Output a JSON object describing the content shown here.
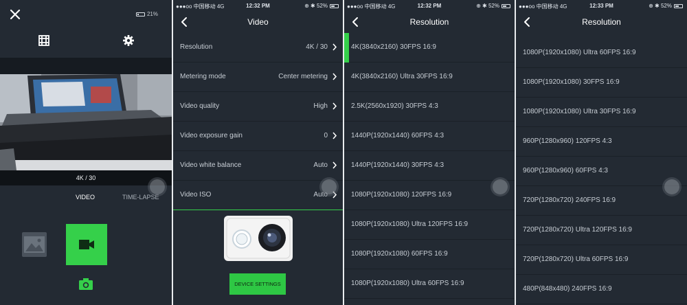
{
  "panel1": {
    "battery_text": "21%",
    "resolution_label": "4K / 30",
    "modes": {
      "video": "VIDEO",
      "timelapse": "TIME-LAPSE"
    },
    "icons": [
      "close-icon",
      "grid-icon",
      "gear-icon",
      "gallery-icon",
      "video-camera-icon",
      "camera-icon"
    ],
    "accent": "#35d04a"
  },
  "status_bars": [
    {
      "carrier": "●●●oo 中国移动  4G",
      "time": "12:32 PM",
      "right": "52%"
    },
    {
      "carrier": "●●●oo 中国移动  4G",
      "time": "12:32 PM",
      "right": "52%"
    },
    {
      "carrier": "●●●oo 中国移动  4G",
      "time": "12:33 PM",
      "right": "52%"
    }
  ],
  "video_screen": {
    "title": "Video",
    "rows": [
      {
        "label": "Resolution",
        "value": "4K / 30"
      },
      {
        "label": "Metering mode",
        "value": "Center metering"
      },
      {
        "label": "Video quality",
        "value": "High"
      },
      {
        "label": "Video exposure gain",
        "value": "0"
      },
      {
        "label": "Video white balance",
        "value": "Auto"
      },
      {
        "label": "Video ISO",
        "value": "Auto"
      }
    ],
    "device_settings_label": "DEVICE SETTINGS"
  },
  "resolution_screen_1": {
    "title": "Resolution",
    "options": [
      "4K(3840x2160) 30FPS 16:9",
      "4K(3840x2160) Ultra 30FPS 16:9",
      "2.5K(2560x1920) 30FPS 4:3",
      "1440P(1920x1440) 60FPS 4:3",
      "1440P(1920x1440) 30FPS 4:3",
      "1080P(1920x1080) 120FPS 16:9",
      "1080P(1920x1080) Ultra 120FPS 16:9",
      "1080P(1920x1080) 60FPS 16:9",
      "1080P(1920x1080) Ultra 60FPS 16:9"
    ],
    "selected_index": 0
  },
  "resolution_screen_2": {
    "title": "Resolution",
    "options": [
      "1080P(1920x1080) Ultra 60FPS 16:9",
      "1080P(1920x1080) 30FPS 16:9",
      "1080P(1920x1080) Ultra 30FPS 16:9",
      "960P(1280x960) 120FPS 4:3",
      "960P(1280x960) 60FPS 4:3",
      "720P(1280x720) 240FPS 16:9",
      "720P(1280x720) Ultra 120FPS 16:9",
      "720P(1280x720) Ultra 60FPS 16:9",
      "480P(848x480) 240FPS 16:9"
    ]
  }
}
